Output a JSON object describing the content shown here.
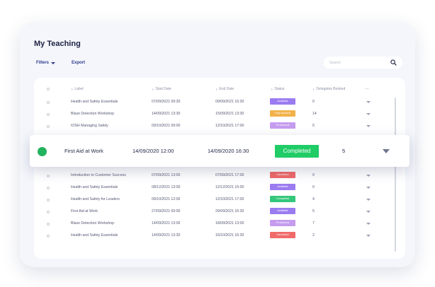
{
  "title": "My Teaching",
  "toolbar": {
    "filters_label": "Filters",
    "export_label": "Export"
  },
  "search": {
    "placeholder": "Search"
  },
  "columns": [
    "Label",
    "Start Date",
    "End Date",
    "Status",
    "Delegates Booked"
  ],
  "more_label": "...",
  "rows": [
    {
      "label": "Health and Safety Essentials",
      "start": "07/09/2021  09:30",
      "end": "09/09/2021  16:30",
      "status": "Available",
      "status_color": "#9b7cf0",
      "delegates": "0"
    },
    {
      "label": "Blaze Detection Workshop",
      "start": "14/09/2021  13:30",
      "end": "15/09/2021  13:30",
      "status": "Fully Booked",
      "status_color": "#f2b24b",
      "delegates": "14"
    },
    {
      "label": "IOSH Managing Safely",
      "start": "09/10/2021  09:00",
      "end": "12/10/2021  17:00",
      "status": "Provisional",
      "status_color": "#c59cef",
      "delegates": "5"
    },
    {
      "label": "Introduction to Customer Success",
      "start": "07/09/2021  13:00",
      "end": "07/09/2021  17:00",
      "status": "Cancelled",
      "status_color": "#f06a6a",
      "delegates": "0"
    },
    {
      "label": "Health and Safety Essentials",
      "start": "08/12/2021  13:00",
      "end": "12/12/2021  15:00",
      "status": "Available",
      "status_color": "#9b7cf0",
      "delegates": "0"
    },
    {
      "label": "Health and Safety for Leaders",
      "start": "09/10/2021  12:00",
      "end": "12/10/2021  17:00",
      "status": "Completed",
      "status_color": "#34c77b",
      "delegates": "4"
    },
    {
      "label": "First Aid at Work",
      "start": "27/09/2021  09:00",
      "end": "29/09/2021  16:30",
      "status": "Available",
      "status_color": "#9b7cf0",
      "delegates": "5"
    },
    {
      "label": "Blaze Detection Workshop",
      "start": "14/09/2021  13:00",
      "end": "18/09/2021  13:00",
      "status": "Provisional",
      "status_color": "#c59cef",
      "delegates": "7"
    },
    {
      "label": "Health and Safety Essentials",
      "start": "14/09/2021  13:30",
      "end": "16/10/2021  16:30",
      "status": "Cancelled",
      "status_color": "#f06a6a",
      "delegates": "2"
    }
  ],
  "highlight": {
    "label": "First Aid at Work",
    "start": "14/09/2020  12:00",
    "end": "14/09/2020  16:30",
    "status": "Completed",
    "status_color": "#1fcc66",
    "delegates": "5"
  },
  "icons": {
    "search": "search-icon",
    "sort": "sort-icon",
    "more": "more-icon",
    "filters_caret": "chevron-down-icon",
    "row_expand": "chevron-down-icon"
  }
}
